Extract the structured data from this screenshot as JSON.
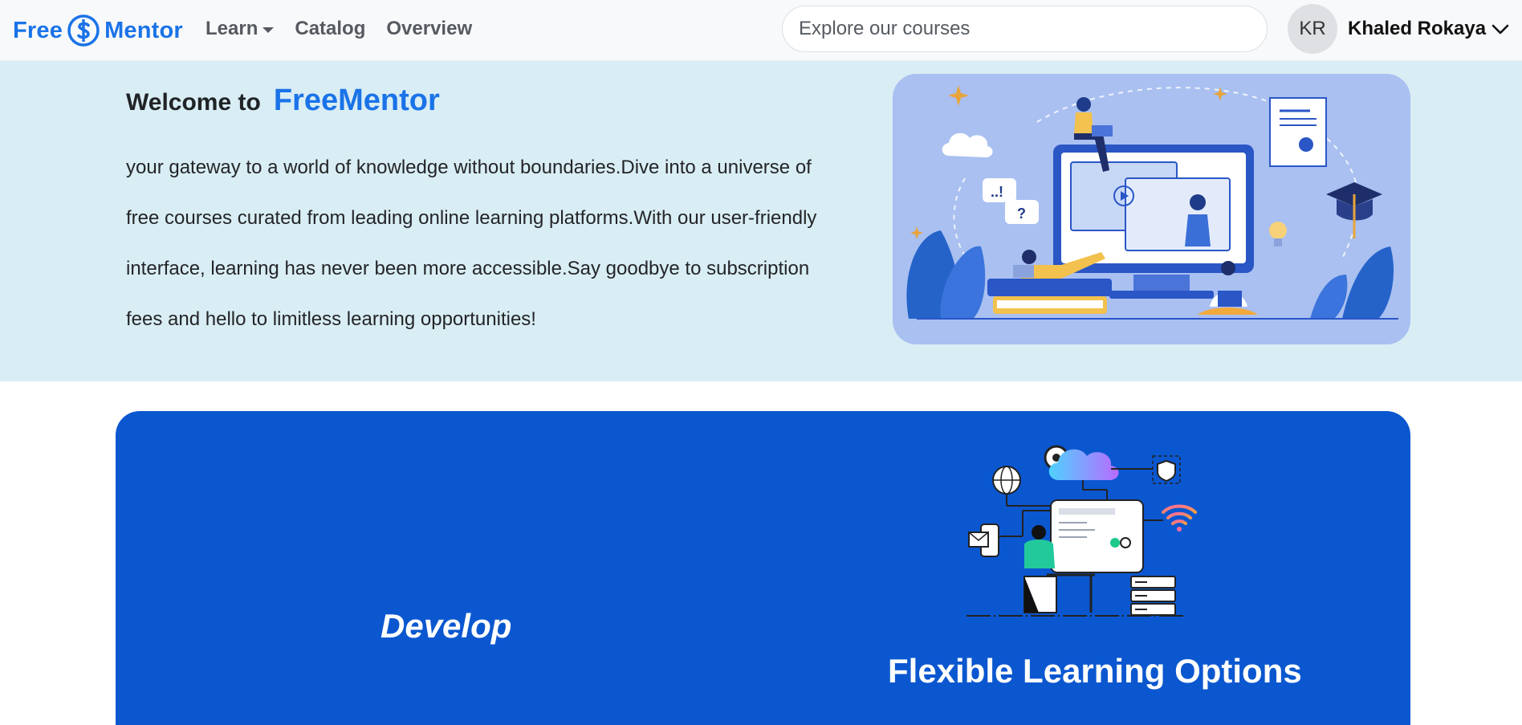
{
  "navbar": {
    "brand_left": "Free",
    "brand_right": "Mentor",
    "links": [
      {
        "label": "Learn",
        "has_dropdown": true
      },
      {
        "label": "Catalog"
      },
      {
        "label": "Overview"
      }
    ],
    "search_placeholder": "Explore our courses",
    "user": {
      "initials": "KR",
      "name": "Khaled Rokaya"
    }
  },
  "hero": {
    "welcome_prefix": "Welcome to",
    "welcome_brand": "FreeMentor",
    "description": "your gateway to a world of knowledge without boundaries.Dive into a universe of free courses curated from leading online learning platforms.With our user-friendly interface, learning has never been more accessible.Say goodbye to subscription fees and hello to limitless learning opportunities!"
  },
  "feature": {
    "left_label": "Develop",
    "title": "Flexible Learning Options"
  },
  "colors": {
    "brand_blue": "#1a73e8",
    "hero_bg": "#d9edf4",
    "feature_bg": "#0b57d0",
    "navbar_bg": "#f8f9fa"
  },
  "icons": [
    "dollar-logo-icon",
    "caret-down-icon",
    "chevron-down-icon"
  ]
}
